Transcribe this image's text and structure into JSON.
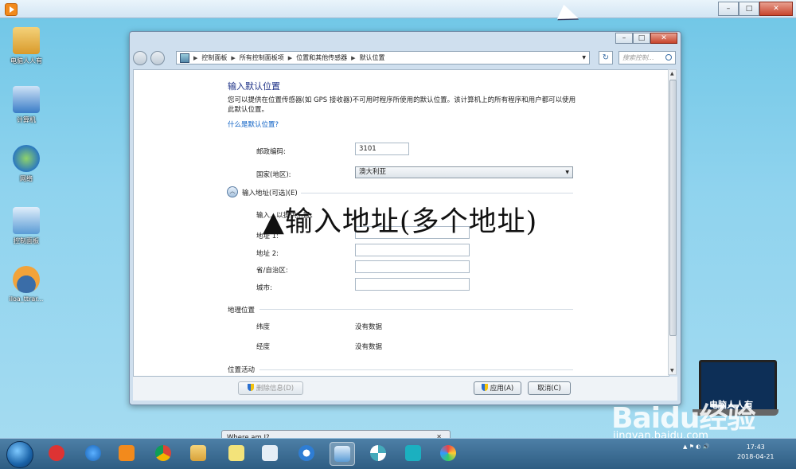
{
  "desktop": {
    "icons": [
      {
        "label": "电脑人人有",
        "color": "#e9b040"
      },
      {
        "label": "计算机",
        "color": "#3a7cc7"
      },
      {
        "label": "网络",
        "color": "#3aa0d8"
      },
      {
        "label": "控制面板",
        "color": "#5a9bd5"
      },
      {
        "label": "iloa_ttrar...",
        "color": "#f2a33a"
      }
    ]
  },
  "window": {
    "breadcrumbs": [
      "控制面板",
      "所有控制面板项",
      "位置和其他传感器",
      "默认位置"
    ],
    "search_placeholder": "搜索控制...",
    "heading": "输入默认位置",
    "description": "您可以提供在位置传感器(如 GPS 接收器)不可用时程序所使用的默认位置。该计算机上的所有程序和用户都可以使用此默认位置。",
    "help_link": "什么是默认位置?",
    "fields": {
      "postal_label": "邮政编码:",
      "postal_value": "3101",
      "country_label": "国家(地区):",
      "country_value": "澳大利亚"
    },
    "address_section": {
      "title": "输入地址(可选)(E)",
      "note": "输入...以提供...置。",
      "address1_label": "地址 1:",
      "address2_label": "地址 2:",
      "province_label": "省/自治区:",
      "city_label": "城市:"
    },
    "geo_section": {
      "title": "地理位置",
      "latitude_label": "纬度",
      "latitude_value": "没有数据",
      "longitude_label": "经度",
      "longitude_value": "没有数据"
    },
    "activity_section_title": "位置活动",
    "buttons": {
      "delete": "删除信息(D)",
      "apply": "应用(A)",
      "cancel": "取消(C)"
    }
  },
  "overlay_caption": "▲输入地址(多个地址)",
  "taskbar": {
    "popup_title": "Where am I?",
    "popup_close": "✕",
    "time": "17:43",
    "date": "2018-04-21"
  },
  "watermark": {
    "laptop_text": "电脑人人有",
    "site": "jingyan.baidu.com",
    "brand": "Baidu经验"
  }
}
